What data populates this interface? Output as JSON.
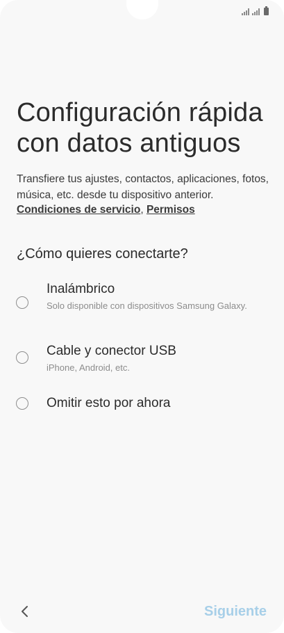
{
  "screen": {
    "title": "Configuración rápida con datos antiguos",
    "description": "Transfiere tus ajustes, contactos, aplicaciones, fotos, música, etc. desde tu dispositivo anterior.",
    "links": {
      "terms": "Condiciones de servicio",
      "separator": ",",
      "permissions": "Permisos"
    },
    "question": "¿Cómo quieres conectarte?"
  },
  "options": [
    {
      "label": "Inalámbrico",
      "sublabel": "Solo disponible con dispositivos Samsung Galaxy.",
      "selected": false
    },
    {
      "label": "Cable y conector USB",
      "sublabel": "iPhone, Android, etc.",
      "selected": false
    },
    {
      "label": "Omitir esto por ahora",
      "selected": false
    }
  ],
  "footer": {
    "back_icon": "chevron-left-icon",
    "next_label": "Siguiente",
    "next_enabled": false
  },
  "status_bar": {
    "icons": [
      "signal-icon",
      "signal-icon",
      "battery-icon"
    ]
  },
  "colors": {
    "background": "#f8f8f8",
    "text_primary": "#2b2b2b",
    "text_secondary": "#8c8c8c",
    "radio_border": "#8e8e8e",
    "next_disabled": "#a7cfe8"
  }
}
